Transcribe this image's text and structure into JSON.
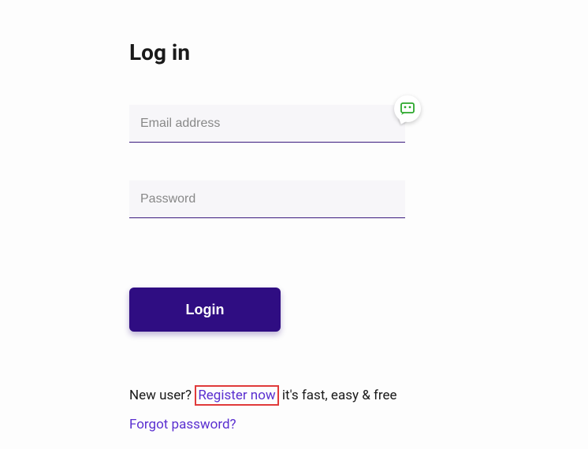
{
  "title": "Log in",
  "email": {
    "placeholder": "Email address",
    "value": ""
  },
  "password": {
    "placeholder": "Password",
    "value": ""
  },
  "login_button": "Login",
  "footer": {
    "new_user_pre": "New user? ",
    "register": "Register now",
    "new_user_post": " it's fast, easy & free",
    "forgot": "Forgot password?"
  },
  "icons": {
    "chatbot": "chatbot-icon"
  }
}
